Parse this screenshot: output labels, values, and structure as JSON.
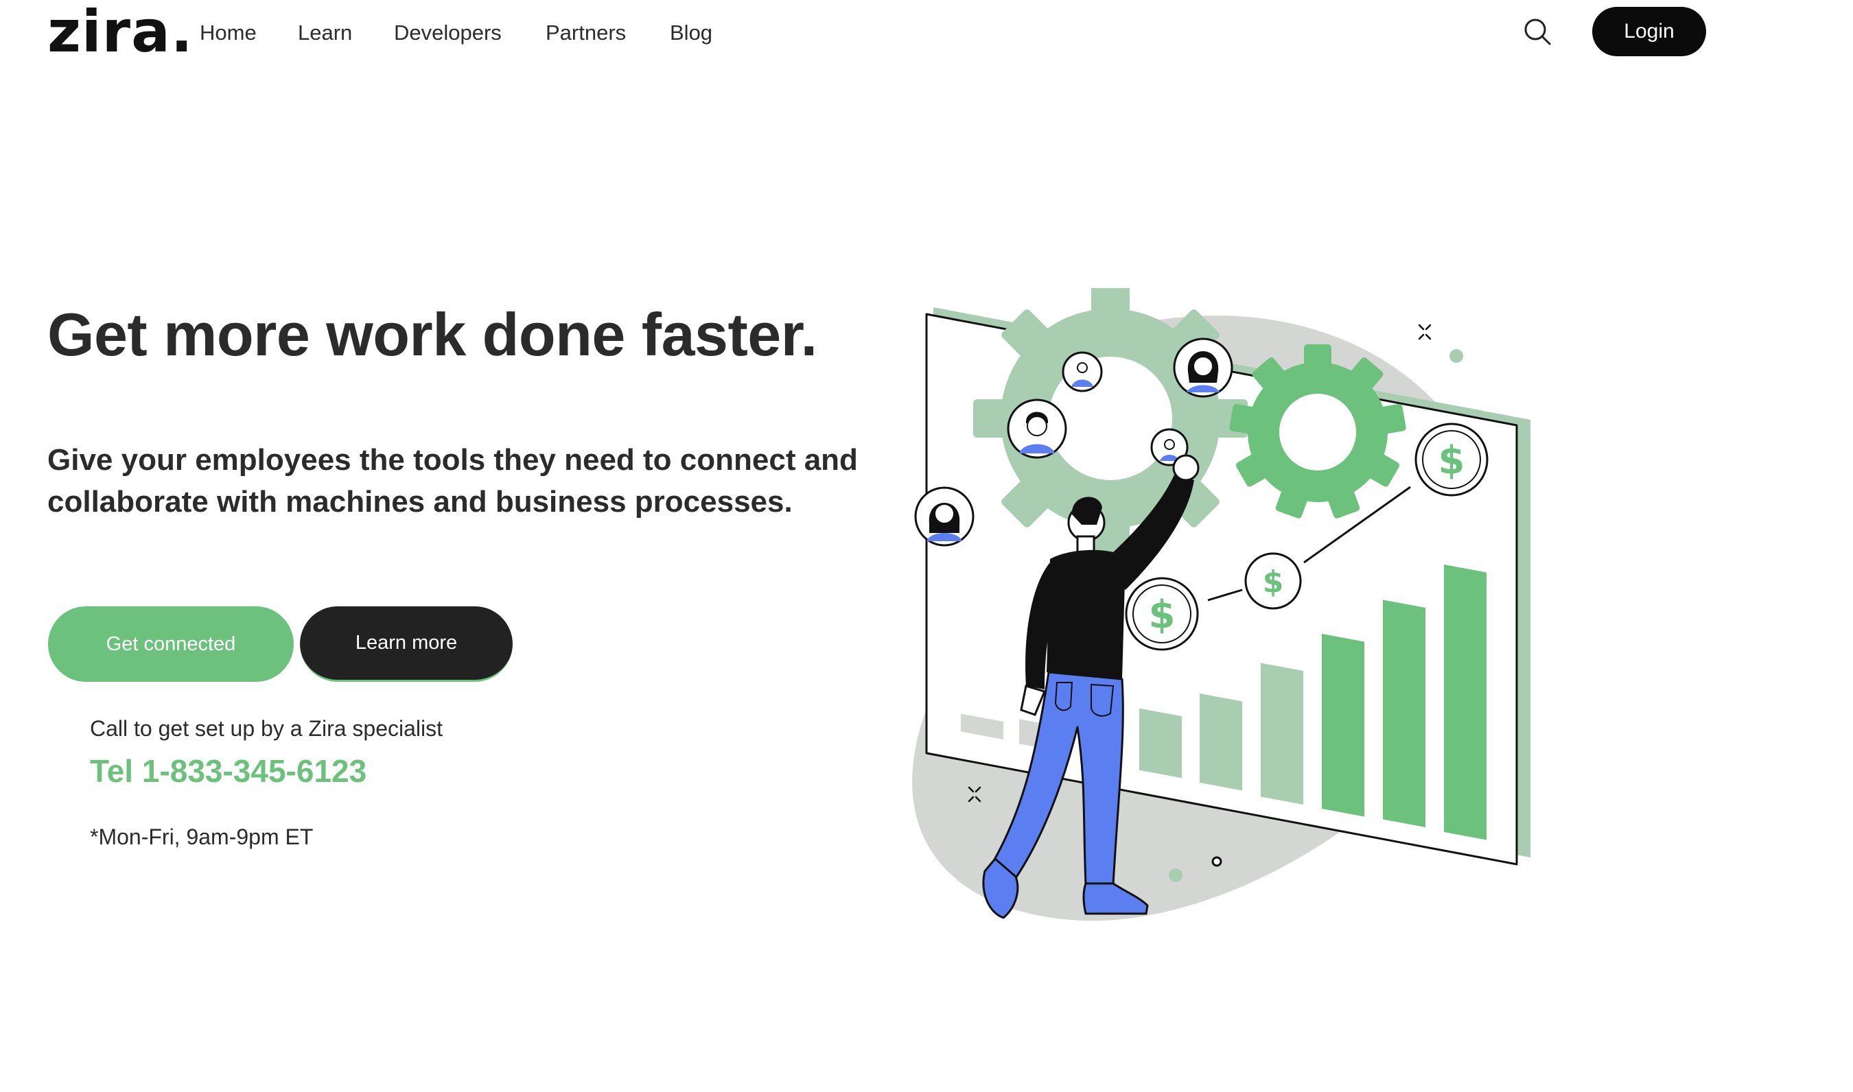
{
  "brand": {
    "logo_text": "zira."
  },
  "nav": {
    "items": [
      {
        "label": "Home"
      },
      {
        "label": "Learn"
      },
      {
        "label": "Developers"
      },
      {
        "label": "Partners"
      },
      {
        "label": "Blog"
      }
    ],
    "search_icon": "search-icon",
    "login_label": "Login"
  },
  "hero": {
    "title": "Get more work done faster.",
    "subtitle": "Give your employees the tools they need to connect and collaborate with machines and business processes.",
    "primary_button": "Get connected",
    "secondary_button": "Learn more",
    "call_text": "Call to get set up by a Zira specialist",
    "tel": "Tel 1-833-345-6123",
    "hours": "*Mon-Fri, 9am-9pm ET"
  },
  "illustration": {
    "icon": "man-with-gears-and-growth-chart-illustration",
    "chart_bar_values": [
      1,
      2,
      3,
      4,
      5,
      6,
      7,
      8,
      9
    ]
  },
  "colors": {
    "accent": "#6cc17c",
    "accent_light": "#a9cdb1",
    "text": "#2b2b2b",
    "dark_button": "#222222",
    "jeans": "#5b7ff0",
    "blob": "#d4d6d3"
  }
}
